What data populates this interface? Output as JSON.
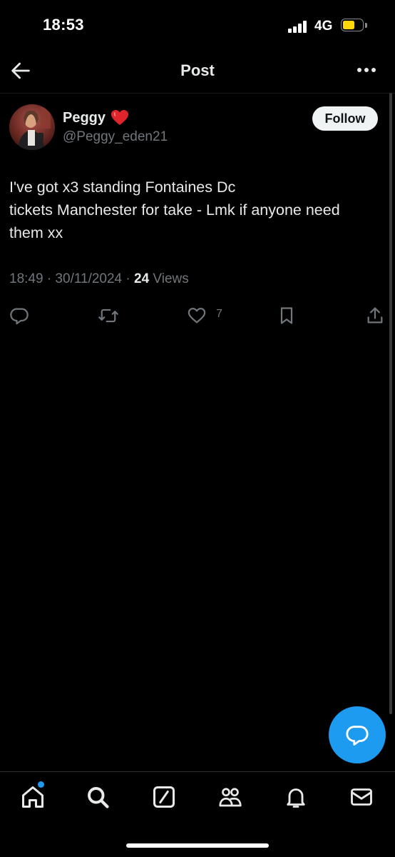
{
  "status_bar": {
    "time": "18:53",
    "network": "4G",
    "battery_color": "#ffd60a"
  },
  "header": {
    "title": "Post",
    "back_icon": "arrow-left-icon",
    "more_icon": "more-horizontal-icon"
  },
  "post": {
    "author": {
      "display_name": "Peggy",
      "emoji": "red-heart",
      "handle": "@Peggy_eden21",
      "follow_label": "Follow"
    },
    "text": "I've got x3 standing Fontaines Dc\ntickets Manchester for take - Lmk if anyone need\nthem xx",
    "timestamp": "18:49 · 30/11/2024 · ",
    "views_count": "24",
    "views_label": " Views",
    "actions": {
      "reply_icon": "reply-icon",
      "repost_icon": "repost-icon",
      "like_icon": "heart-icon",
      "like_count": "7",
      "bookmark_icon": "bookmark-icon",
      "share_icon": "share-icon"
    }
  },
  "fab": {
    "icon": "reply-bubble-icon",
    "color": "#1d9bf0"
  },
  "bottom_nav": {
    "items": [
      {
        "name": "home",
        "icon": "home-icon",
        "has_notification_dot": true
      },
      {
        "name": "search",
        "icon": "search-icon"
      },
      {
        "name": "grok",
        "icon": "grok-icon"
      },
      {
        "name": "communities",
        "icon": "people-icon"
      },
      {
        "name": "notifications",
        "icon": "bell-icon"
      },
      {
        "name": "messages",
        "icon": "envelope-icon"
      }
    ]
  },
  "colors": {
    "background": "#000000",
    "text_primary": "#e7e9ea",
    "text_secondary": "#71767b",
    "accent": "#1d9bf0"
  }
}
